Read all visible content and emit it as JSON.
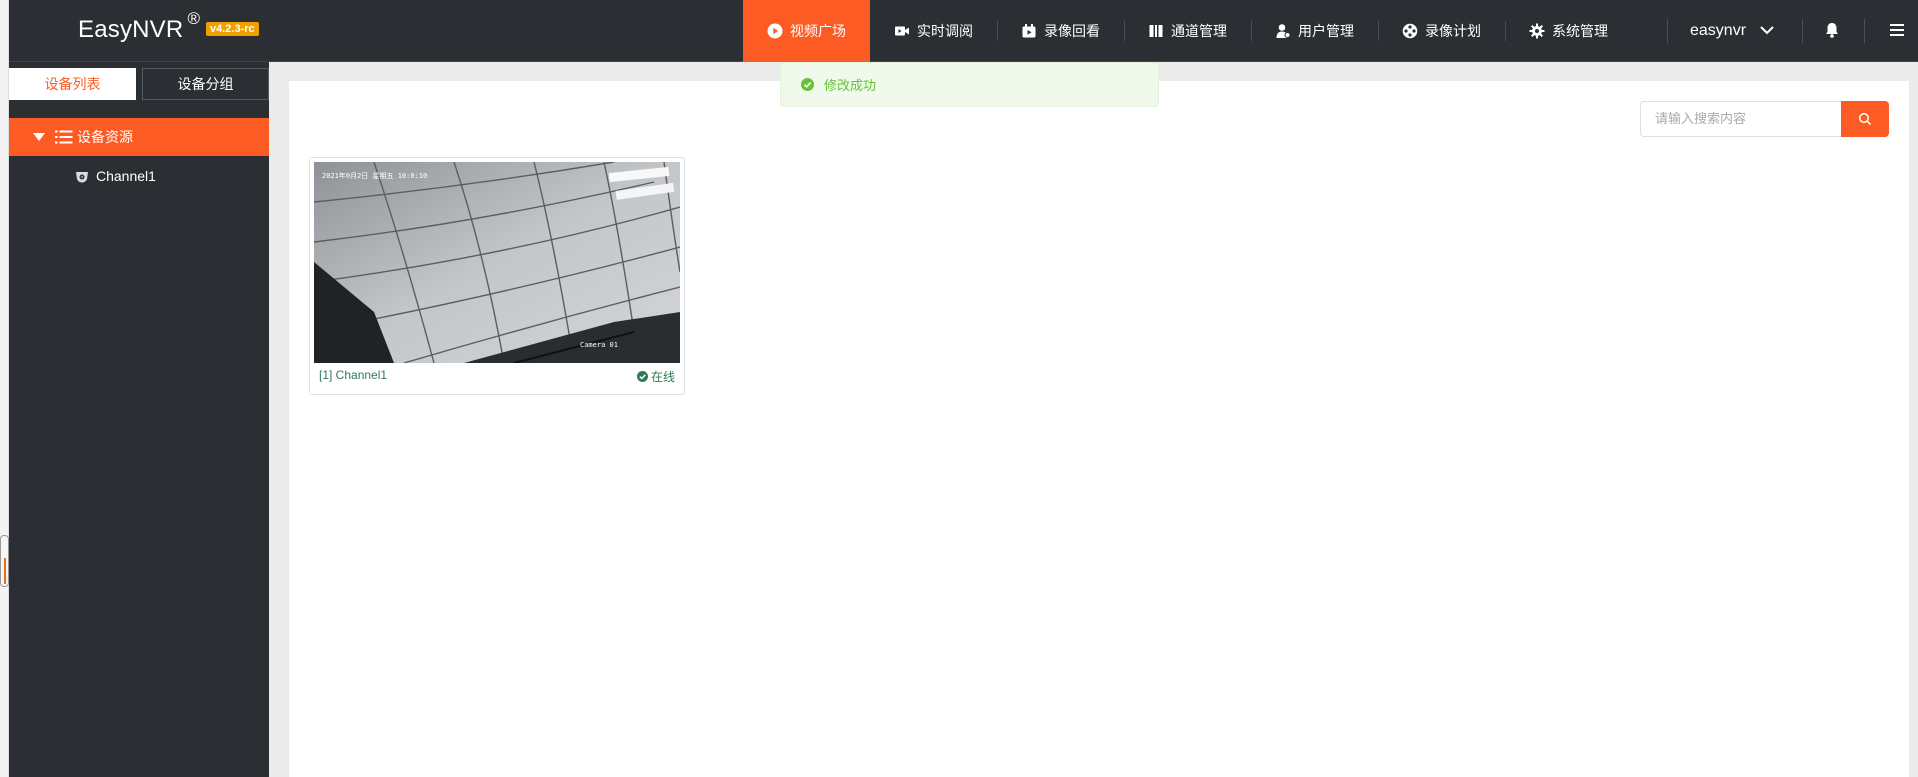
{
  "header": {
    "brand": "EasyNVR",
    "registered": "®",
    "version": "v4.2.3-rc",
    "nav": [
      {
        "label": "视频广场",
        "icon": "play-circle-icon",
        "active": true
      },
      {
        "label": "实时调阅",
        "icon": "video-camera-icon",
        "active": false
      },
      {
        "label": "录像回看",
        "icon": "playback-icon",
        "active": false
      },
      {
        "label": "通道管理",
        "icon": "channel-icon",
        "active": false
      },
      {
        "label": "用户管理",
        "icon": "user-icon",
        "active": false
      },
      {
        "label": "录像计划",
        "icon": "film-reel-icon",
        "active": false
      },
      {
        "label": "系统管理",
        "icon": "gear-icon",
        "active": false
      }
    ],
    "username": "easynvr"
  },
  "sidebar": {
    "tabs": [
      "设备列表",
      "设备分组"
    ],
    "tree_root": "设备资源",
    "tree_children": [
      "Channel1"
    ]
  },
  "search": {
    "placeholder": "请输入搜索内容"
  },
  "toast": {
    "message": "修改成功"
  },
  "cards": [
    {
      "title": "[1] Channel1",
      "status": "在线",
      "osd_top": "2021年0月2日 星期五 10:0:10",
      "osd_bottom": "Camera 01"
    }
  ],
  "colors": {
    "accent": "#fd5b24",
    "topbar": "#2b2f33",
    "online": "#2d7a57",
    "version_badge": "#f0a000"
  }
}
